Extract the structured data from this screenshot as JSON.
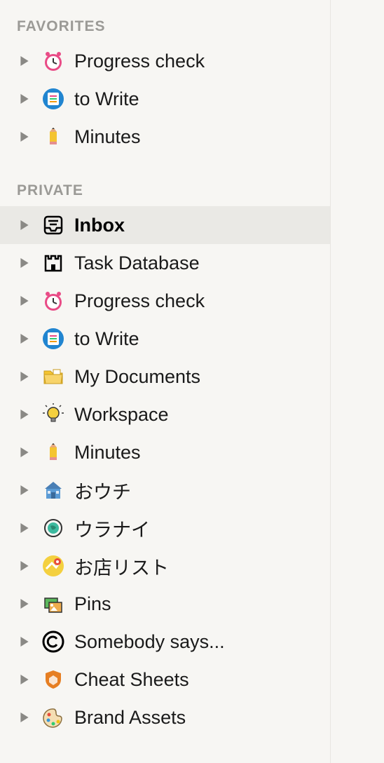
{
  "sections": [
    {
      "title": "FAVORITES",
      "items": [
        {
          "icon": "clock-icon",
          "label": "Progress check",
          "selected": false
        },
        {
          "icon": "note-icon",
          "label": "to Write",
          "selected": false
        },
        {
          "icon": "pencil-icon",
          "label": "Minutes",
          "selected": false
        }
      ]
    },
    {
      "title": "PRIVATE",
      "items": [
        {
          "icon": "inbox-icon",
          "label": "Inbox",
          "selected": true
        },
        {
          "icon": "castle-icon",
          "label": "Task Database",
          "selected": false
        },
        {
          "icon": "clock-icon",
          "label": "Progress check",
          "selected": false
        },
        {
          "icon": "note-icon",
          "label": "to Write",
          "selected": false
        },
        {
          "icon": "folder-icon",
          "label": "My Documents",
          "selected": false
        },
        {
          "icon": "bulb-icon",
          "label": "Workspace",
          "selected": false
        },
        {
          "icon": "pencil-icon",
          "label": "Minutes",
          "selected": false
        },
        {
          "icon": "house-icon",
          "label": "おウチ",
          "selected": false
        },
        {
          "icon": "globe-icon",
          "label": "ウラナイ",
          "selected": false
        },
        {
          "icon": "map-icon",
          "label": "お店リスト",
          "selected": false
        },
        {
          "icon": "pins-icon",
          "label": "Pins",
          "selected": false
        },
        {
          "icon": "copyright-icon",
          "label": "Somebody says...",
          "selected": false
        },
        {
          "icon": "shield-icon",
          "label": "Cheat Sheets",
          "selected": false
        },
        {
          "icon": "palette-icon",
          "label": "Brand Assets",
          "selected": false
        }
      ]
    }
  ]
}
